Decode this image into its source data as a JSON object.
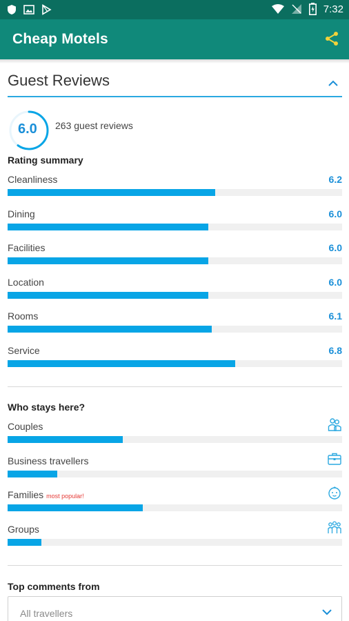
{
  "status_bar": {
    "time": "7:32"
  },
  "app_bar": {
    "title": "Cheap Motels"
  },
  "section": {
    "title": "Guest Reviews"
  },
  "overall": {
    "score": "6.0",
    "score_fraction": 0.6,
    "review_count": "263 guest reviews"
  },
  "rating_summary": {
    "heading": "Rating summary",
    "items": [
      {
        "label": "Cleanliness",
        "value": "6.2",
        "fraction": 0.62
      },
      {
        "label": "Dining",
        "value": "6.0",
        "fraction": 0.6
      },
      {
        "label": "Facilities",
        "value": "6.0",
        "fraction": 0.6
      },
      {
        "label": "Location",
        "value": "6.0",
        "fraction": 0.6
      },
      {
        "label": "Rooms",
        "value": "6.1",
        "fraction": 0.61
      },
      {
        "label": "Service",
        "value": "6.8",
        "fraction": 0.68
      }
    ]
  },
  "who_stays": {
    "heading": "Who stays here?",
    "items": [
      {
        "label": "Couples",
        "badge": "",
        "fraction": 0.345,
        "icon": "couple-icon"
      },
      {
        "label": "Business travellers",
        "badge": "",
        "fraction": 0.148,
        "icon": "briefcase-icon"
      },
      {
        "label": "Families",
        "badge": "most popular!",
        "fraction": 0.405,
        "icon": "baby-face-icon"
      },
      {
        "label": "Groups",
        "badge": "",
        "fraction": 0.1,
        "icon": "group-icon"
      }
    ]
  },
  "top_comments": {
    "heading": "Top comments from",
    "selected": "All travellers"
  },
  "colors": {
    "status_bar": "#0b6e5f",
    "app_bar": "#10897a",
    "accent": "#08a5e6",
    "share_icon": "#f2d33a",
    "badge": "#e53935"
  }
}
